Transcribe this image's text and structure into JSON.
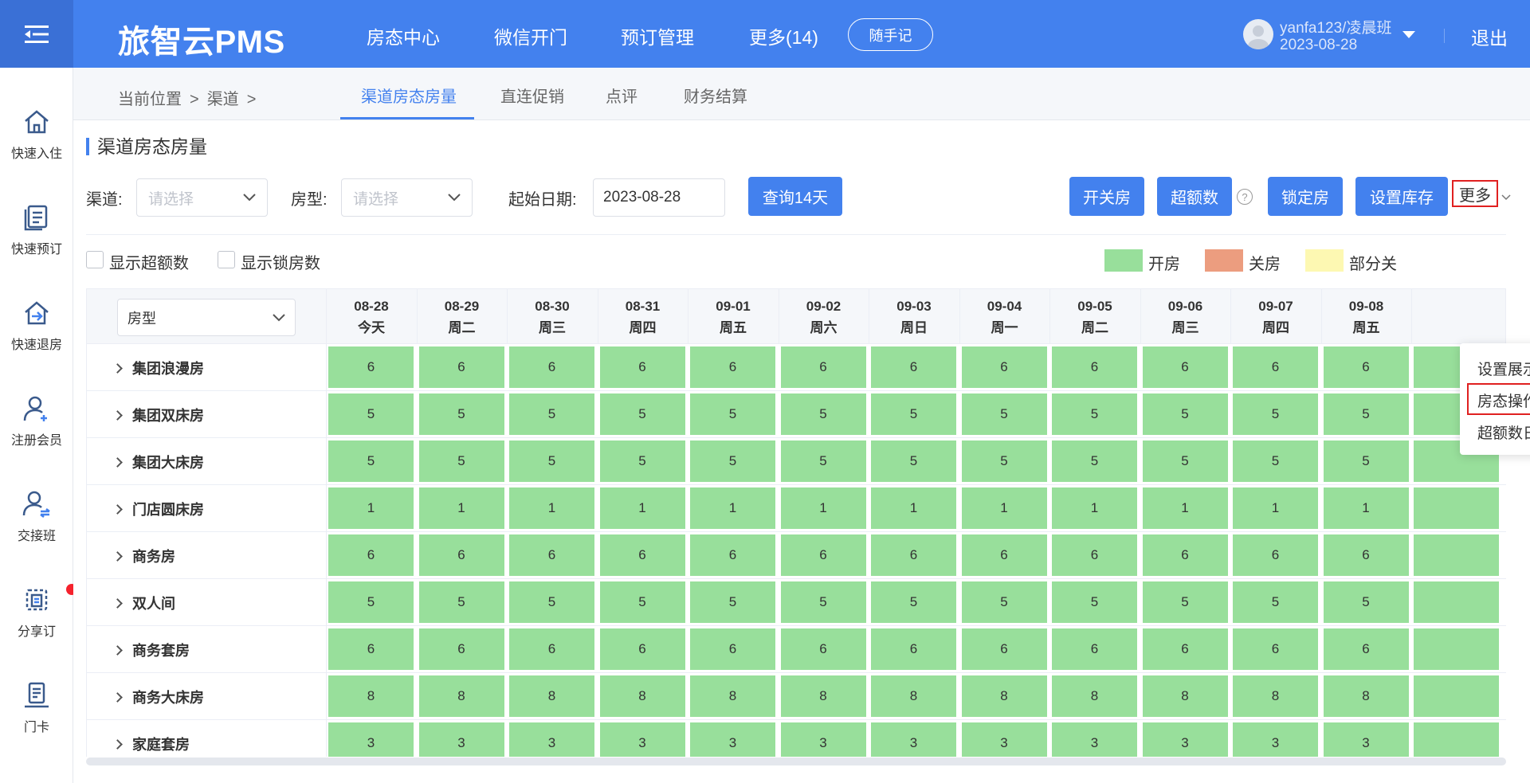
{
  "app": {
    "brand": "旅智云PMS",
    "nav": [
      "房态中心",
      "微信开门",
      "预订管理",
      "更多(14)"
    ],
    "notes_label": "随手记",
    "user_name": "yanfa123/凌晨班",
    "user_date": "2023-08-28",
    "logout": "退出"
  },
  "sidebar": [
    {
      "label": "快速入住",
      "icon": "home-icon"
    },
    {
      "label": "快速预订",
      "icon": "document-icon"
    },
    {
      "label": "快速退房",
      "icon": "checkout-icon"
    },
    {
      "label": "注册会员",
      "icon": "add-user-icon"
    },
    {
      "label": "交接班",
      "icon": "handover-icon"
    },
    {
      "label": "分享订",
      "icon": "share-icon",
      "badge": true
    },
    {
      "label": "门卡",
      "icon": "card-icon"
    }
  ],
  "breadcrumb": [
    "当前位置",
    ">",
    "渠道",
    ">"
  ],
  "tabs": [
    "渠道房态房量",
    "直连促销",
    "点评",
    "财务结算"
  ],
  "panel_title": "渠道房态房量",
  "filters": {
    "channel_label": "渠道:",
    "channel_placeholder": "请选择",
    "roomtype_label": "房型:",
    "roomtype_placeholder": "请选择",
    "date_label": "起始日期:",
    "date_value": "2023-08-28",
    "query_button": "查询14天"
  },
  "actions": {
    "open_close": "开关房",
    "over_quota": "超额数",
    "lock_room": "锁定房",
    "set_stock": "设置库存",
    "more": "更多"
  },
  "checkboxes": {
    "show_over": "显示超额数",
    "show_locked": "显示锁房数"
  },
  "legend": [
    {
      "label": "开房",
      "color": "#98df9b"
    },
    {
      "label": "关房",
      "color": "#ec9d7f"
    },
    {
      "label": "部分关",
      "color": "#fdf8b2"
    }
  ],
  "grid": {
    "roomtype_filter": "房型",
    "dates": [
      {
        "date": "08-28",
        "day": "今天"
      },
      {
        "date": "08-29",
        "day": "周二"
      },
      {
        "date": "08-30",
        "day": "周三"
      },
      {
        "date": "08-31",
        "day": "周四"
      },
      {
        "date": "09-01",
        "day": "周五"
      },
      {
        "date": "09-02",
        "day": "周六"
      },
      {
        "date": "09-03",
        "day": "周日"
      },
      {
        "date": "09-04",
        "day": "周一"
      },
      {
        "date": "09-05",
        "day": "周二"
      },
      {
        "date": "09-06",
        "day": "周三"
      },
      {
        "date": "09-07",
        "day": "周四"
      },
      {
        "date": "09-08",
        "day": "周五"
      },
      {
        "date": "",
        "day": ""
      }
    ],
    "rows": [
      {
        "name": "集团浪漫房",
        "value": "6"
      },
      {
        "name": "集团双床房",
        "value": "5"
      },
      {
        "name": "集团大床房",
        "value": "5"
      },
      {
        "name": "门店圆床房",
        "value": "1"
      },
      {
        "name": "商务房",
        "value": "6"
      },
      {
        "name": "双人间",
        "value": "5"
      },
      {
        "name": "商务套房",
        "value": "6"
      },
      {
        "name": "商务大床房",
        "value": "8"
      },
      {
        "name": "家庭套房",
        "value": "3"
      }
    ],
    "open_color": "#98df9b"
  },
  "more_menu": [
    "设置展示渠道",
    "房态操作记录",
    "超额数日志"
  ]
}
